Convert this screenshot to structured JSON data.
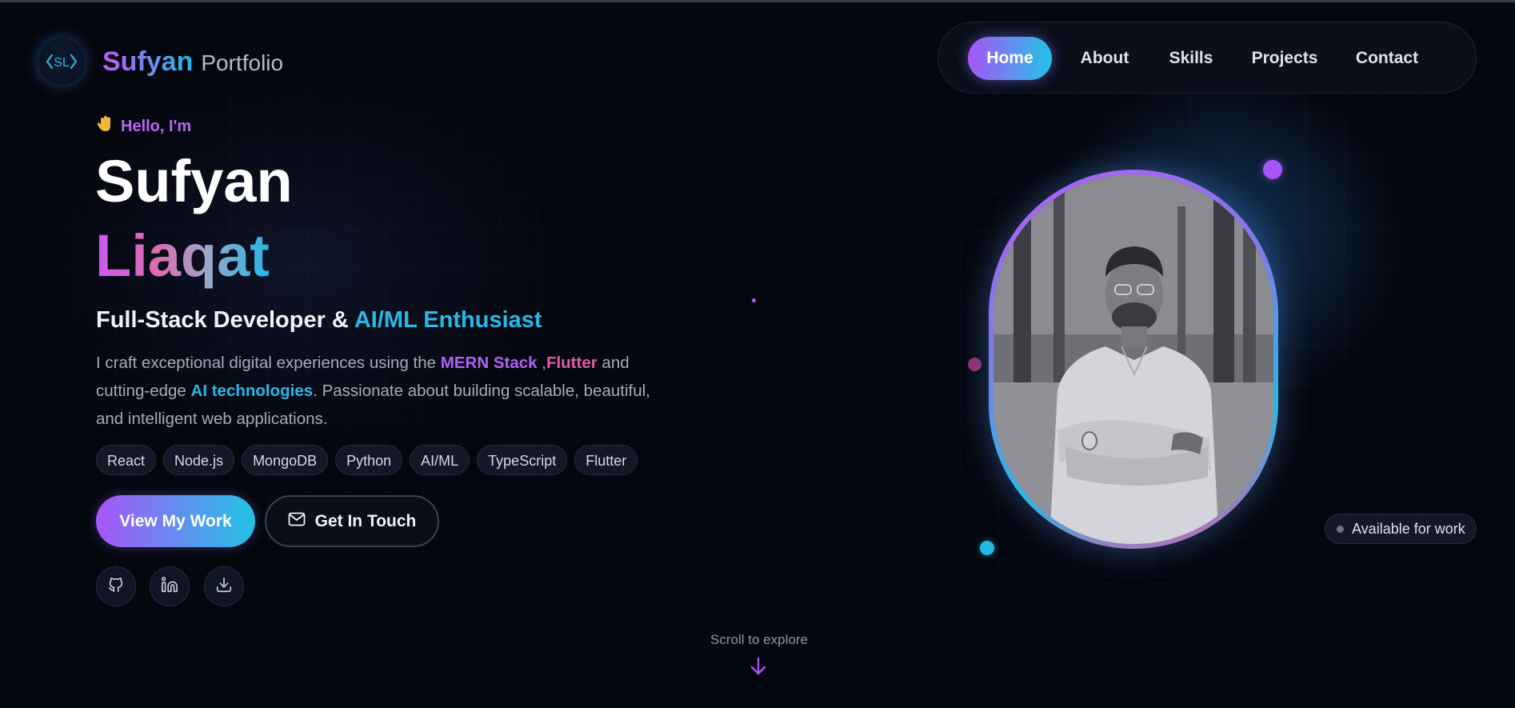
{
  "brand": {
    "logo_mark": "‹SL›",
    "name": "Sufyan",
    "suffix": "Portfolio"
  },
  "nav": {
    "items": [
      {
        "label": "Home",
        "active": true
      },
      {
        "label": "About",
        "active": false
      },
      {
        "label": "Skills",
        "active": false
      },
      {
        "label": "Projects",
        "active": false
      },
      {
        "label": "Contact",
        "active": false
      }
    ]
  },
  "hero": {
    "greeting": "Hello, I'm",
    "greeting_icon": "waving-hand-icon",
    "first_name": "Sufyan",
    "last_name": "Liaqat",
    "role_prefix": "Full-Stack Developer & ",
    "role_highlight": "AI/ML Enthusiast",
    "description": {
      "part1": "I craft exceptional digital experiences using the ",
      "highlight1": "MERN Stack",
      "part2": " ,",
      "highlight2": "Flutter",
      "part3": " and cutting-edge ",
      "highlight3": "AI technologies",
      "part4": ". Passionate about building scalable, beautiful, and intelligent web applications."
    },
    "tags": [
      "React",
      "Node.js",
      "MongoDB",
      "Python",
      "AI/ML",
      "TypeScript",
      "Flutter"
    ],
    "primary_button": "View My Work",
    "secondary_button": "Get In Touch",
    "secondary_icon": "mail-icon",
    "socials": [
      "github-icon",
      "linkedin-icon",
      "download-icon"
    ]
  },
  "profile": {
    "photo": "profile-photo",
    "status": "Available for work"
  },
  "scroll_hint": {
    "label": "Scroll to explore",
    "icon": "arrow-down-icon"
  },
  "colors": {
    "background": "#05070f",
    "accent_purple": "#a855f7",
    "accent_cyan": "#22c3e6",
    "accent_pink": "#e05aa8"
  }
}
